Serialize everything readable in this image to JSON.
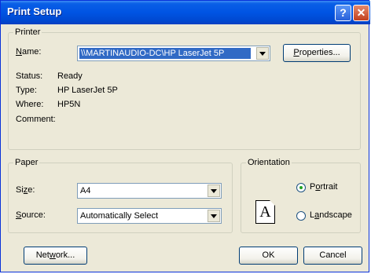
{
  "window": {
    "title": "Print Setup",
    "help_label": "?",
    "close_label": "✕"
  },
  "printer": {
    "group_label": "Printer",
    "name_label_accel": "N",
    "name_label_rest": "ame:",
    "name_value": "\\\\MARTINAUDIO-DC\\HP LaserJet 5P",
    "properties_accel": "P",
    "properties_rest": "roperties...",
    "status_label": "Status:",
    "status_value": "Ready",
    "type_label": "Type:",
    "type_value": "HP LaserJet 5P",
    "where_label": "Where:",
    "where_value": "HP5N",
    "comment_label": "Comment:"
  },
  "paper": {
    "group_label": "Paper",
    "size_label_pre": "Si",
    "size_label_accel": "z",
    "size_label_post": "e:",
    "size_value": "A4",
    "source_label_accel": "S",
    "source_label_rest": "ource:",
    "source_value": "Automatically Select"
  },
  "orientation": {
    "group_label": "Orientation",
    "icon_letter": "A",
    "portrait_pre": "P",
    "portrait_accel": "o",
    "portrait_post": "rtrait",
    "landscape_pre": "L",
    "landscape_accel": "a",
    "landscape_post": "ndscape",
    "selected": "portrait"
  },
  "buttons": {
    "network_pre": "Net",
    "network_accel": "w",
    "network_post": "ork...",
    "ok": "OK",
    "cancel": "Cancel"
  }
}
